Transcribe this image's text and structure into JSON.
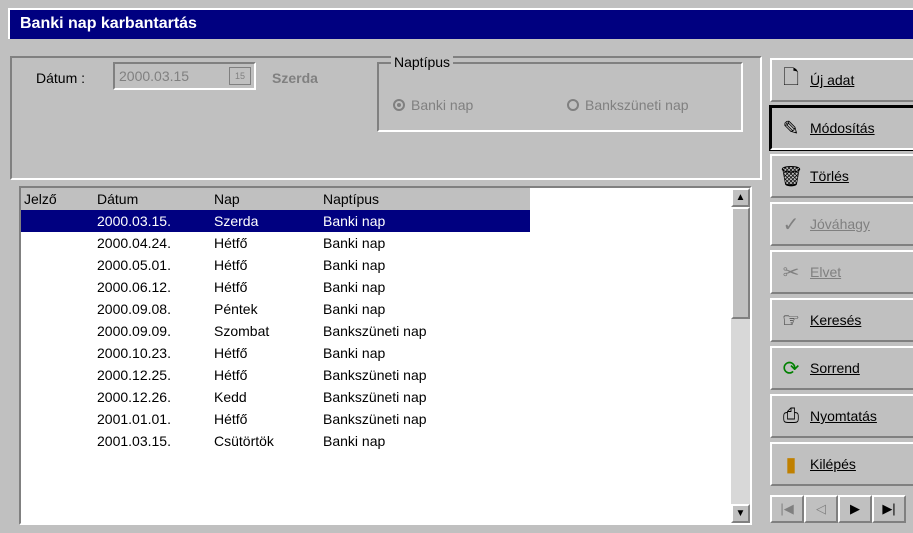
{
  "window": {
    "title": "Banki nap karbantartás"
  },
  "form": {
    "datum_label": "Dátum :",
    "datum_value": "2000.03.15",
    "day_name": "Szerda",
    "naptipus_label": "Naptípus",
    "radio_banki": "Banki nap",
    "radio_bankszuneti": "Bankszüneti nap"
  },
  "table": {
    "columns": [
      "Jelző",
      "Dátum",
      "Nap",
      "Naptípus"
    ],
    "rows": [
      {
        "jelzo": "",
        "datum": "2000.03.15.",
        "nap": "Szerda",
        "tipus": "Banki nap"
      },
      {
        "jelzo": "",
        "datum": "2000.04.24.",
        "nap": "Hétfő",
        "tipus": "Banki nap"
      },
      {
        "jelzo": "",
        "datum": "2000.05.01.",
        "nap": "Hétfő",
        "tipus": "Banki nap"
      },
      {
        "jelzo": "",
        "datum": "2000.06.12.",
        "nap": "Hétfő",
        "tipus": "Banki nap"
      },
      {
        "jelzo": "",
        "datum": "2000.09.08.",
        "nap": "Péntek",
        "tipus": "Banki nap"
      },
      {
        "jelzo": "",
        "datum": "2000.09.09.",
        "nap": "Szombat",
        "tipus": "Bankszüneti nap"
      },
      {
        "jelzo": "",
        "datum": "2000.10.23.",
        "nap": "Hétfő",
        "tipus": "Banki nap"
      },
      {
        "jelzo": "",
        "datum": "2000.12.25.",
        "nap": "Hétfő",
        "tipus": "Bankszüneti nap"
      },
      {
        "jelzo": "",
        "datum": "2000.12.26.",
        "nap": "Kedd",
        "tipus": "Bankszüneti nap"
      },
      {
        "jelzo": "",
        "datum": "2001.01.01.",
        "nap": "Hétfő",
        "tipus": "Bankszüneti nap"
      },
      {
        "jelzo": "",
        "datum": "2001.03.15.",
        "nap": "Csütörtök",
        "tipus": "Banki nap"
      }
    ]
  },
  "buttons": {
    "uj_adat": "Új adat",
    "modositas": "Módosítás",
    "torles": "Törlés",
    "jovahagy": "Jóváhagy",
    "elvet": "Elvet",
    "kereses": "Keresés",
    "sorrend": "Sorrend",
    "nyomtatas": "Nyomtatás",
    "kilepes": "Kilépés"
  },
  "icons": {
    "uj_adat": "new-page-icon",
    "modositas": "edit-icon",
    "torles": "trash-icon",
    "jovahagy": "check-icon",
    "elvet": "scissors-icon",
    "kereses": "hand-pointer-icon",
    "sorrend": "refresh-icon",
    "nyomtatas": "printer-icon",
    "kilepes": "exit-door-icon"
  },
  "colors": {
    "selection": "#000080",
    "title": "#000080",
    "face": "#c0c0c0"
  }
}
